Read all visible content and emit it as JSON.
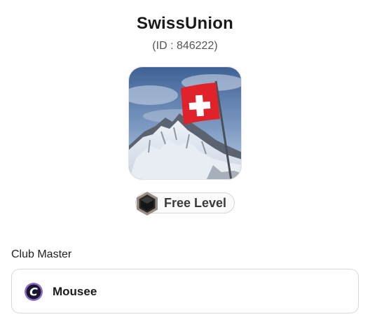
{
  "club": {
    "name": "SwissUnion",
    "id_text": "(ID : 846222)",
    "image": "swiss-flag-on-mountain-photo"
  },
  "level": {
    "label": "Free Level",
    "icon": "hexagon-level-icon"
  },
  "club_master": {
    "section_label": "Club Master",
    "name": "Mousee",
    "avatar_icon": "letter-c-avatar-icon"
  },
  "colors": {
    "flag_red": "#e0232b",
    "sky_blue": "#4d6f9e",
    "avatar_purple": "#8e6cc9"
  }
}
